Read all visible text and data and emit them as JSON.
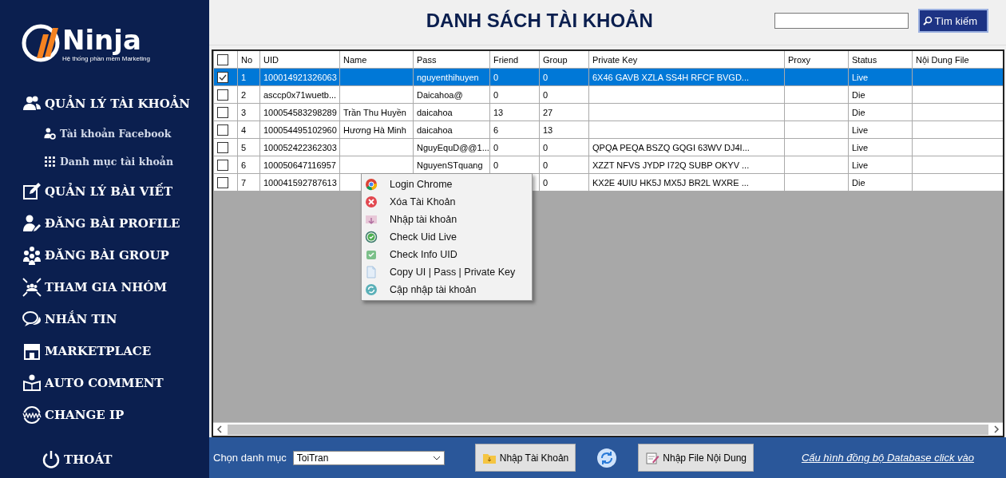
{
  "logo": {
    "name": "Ninja",
    "tagline": "Hệ thống phần mềm Marketing"
  },
  "sidebar": {
    "items": [
      {
        "label": "QUẢN LÝ TÀI KHOẢN",
        "kind": "section"
      },
      {
        "label": "Tài khoản Facebook",
        "kind": "sub"
      },
      {
        "label": "Danh mục tài khoản",
        "kind": "sub"
      },
      {
        "label": "QUẢN LÝ BÀI VIẾT",
        "kind": "section"
      },
      {
        "label": "ĐĂNG BÀI PROFILE",
        "kind": "section"
      },
      {
        "label": "ĐĂNG BÀI GROUP",
        "kind": "section"
      },
      {
        "label": "THAM GIA NHÓM",
        "kind": "section"
      },
      {
        "label": "NHẮN TIN",
        "kind": "section"
      },
      {
        "label": "MARKETPLACE",
        "kind": "section"
      },
      {
        "label": "AUTO COMMENT",
        "kind": "section"
      },
      {
        "label": "CHANGE IP",
        "kind": "section"
      },
      {
        "label": "THOÁT",
        "kind": "logout"
      }
    ]
  },
  "header": {
    "title": "DANH SÁCH TÀI KHOẢN",
    "search_button": "Tìm kiếm"
  },
  "table": {
    "select_all_checked": false,
    "columns": [
      "No",
      "UID",
      "Name",
      "Pass",
      "Friend",
      "Group",
      "Private Key",
      "Proxy",
      "Status",
      "Nội Dung File"
    ],
    "rows": [
      {
        "checked": true,
        "selected": true,
        "cells": [
          "1",
          "100014921326063",
          null,
          "nguyenthihuyen",
          "0",
          "0",
          "6X46 GAVB XZLA SS4H RFCF BVGD...",
          null,
          "Live",
          null
        ]
      },
      {
        "checked": false,
        "selected": false,
        "cells": [
          "2",
          "asccp0x71wuetb...",
          null,
          "Daicahoa@",
          "0",
          "0",
          null,
          null,
          "Die",
          null
        ]
      },
      {
        "checked": false,
        "selected": false,
        "cells": [
          "3",
          "100054583298289",
          "Trần Thu Huyền",
          "daicahoa",
          "13",
          "27",
          null,
          null,
          "Die",
          null
        ]
      },
      {
        "checked": false,
        "selected": false,
        "cells": [
          "4",
          "100054495102960",
          "Hương Hà Minh",
          "daicahoa",
          "6",
          "13",
          null,
          null,
          "Live",
          null
        ]
      },
      {
        "checked": false,
        "selected": false,
        "cells": [
          "5",
          "100052422362303",
          null,
          "NguyEquD@@1...",
          "0",
          "0",
          "QPQA PEQA BSZQ GQGI 63WV DJ4I...",
          null,
          "Live",
          null
        ]
      },
      {
        "checked": false,
        "selected": false,
        "cells": [
          "6",
          "100050647116957",
          null,
          "NguyenSTquang",
          "0",
          "0",
          "XZZT NFVS JYDP I72Q SUBP OKYV ...",
          null,
          "Live",
          null
        ]
      },
      {
        "checked": false,
        "selected": false,
        "cells": [
          "7",
          "100041592787613",
          null,
          null,
          null,
          "0",
          "KX2E 4UIU HK5J MX5J BR2L WXRE ...",
          null,
          "Die",
          null
        ]
      }
    ]
  },
  "context_menu": {
    "items": [
      "Login Chrome",
      "Xóa Tài Khoản",
      "Nhập tài khoản",
      "Check Uid Live",
      "Check Info UID",
      "Copy UI | Pass | Private Key",
      "Cập nhập tài khoản"
    ]
  },
  "bottom_bar": {
    "category_label": "Chọn danh mục",
    "category_value": "ToiTran",
    "import_button": "Nhập Tài Khoản",
    "import_file_button": "Nhập File Nội Dung",
    "sync_link": "Cấu hình đồng bộ Database click vào"
  }
}
